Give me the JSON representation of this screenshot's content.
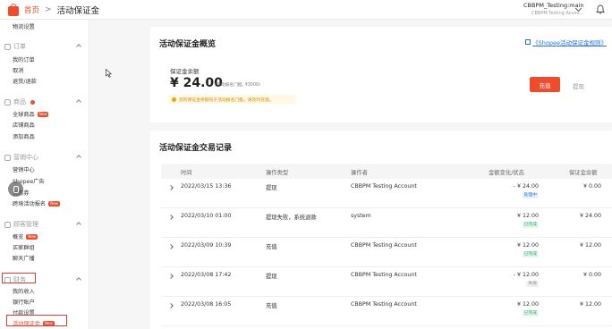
{
  "header": {
    "home_label": "首页",
    "separator": ">",
    "page_title": "活动保证金",
    "shop_name": "CBBPM_Testing:main",
    "shop_sub": "CBBPM Testing Accou..."
  },
  "sidebar": {
    "top_item": "物流设置",
    "sections": [
      {
        "title": "订单",
        "items": [
          "我的订单",
          "取消",
          "退货/退款"
        ]
      },
      {
        "title": "商品",
        "items": [
          "全球商品",
          "店铺商品",
          "添加商品"
        ]
      },
      {
        "title": "营销中心",
        "items": [
          "营销中心",
          "Shopee广告",
          "优惠券",
          "跨境活动报名"
        ]
      },
      {
        "title": "顾客管理",
        "items": [
          "概览",
          "买家群组",
          "聊天广播"
        ]
      },
      {
        "title": "财务",
        "items": [
          "我的收入",
          "银行账户",
          "付款设置",
          "活动保证金"
        ]
      }
    ],
    "new_badge": "New"
  },
  "overview": {
    "title": "活动保证金概览",
    "rule_link": "《Shopee活动保证金规则》",
    "balance_label": "保证金余额",
    "balance_amount": "¥ 24.00",
    "balance_note": "(活动报名门槛, ¥3000)",
    "warning": "您的保证金余额低于活动报名门槛，请及时充值。",
    "recharge_label": "充值",
    "withdraw_label": "提现"
  },
  "transactions": {
    "title": "活动保证金交易记录",
    "headers": [
      "时间",
      "操作类型",
      "操作者",
      "金额变化/状态",
      "保证金余额"
    ],
    "rows": [
      {
        "time": "2022/03/15 13:36",
        "type": "提现",
        "operator": "CBBPM Testing Account",
        "amount": "- ¥ 24.00",
        "status": "处理中",
        "balance": "¥ 0.00"
      },
      {
        "time": "2022/03/10 01:00",
        "type": "提现失败，系统退款",
        "operator": "system",
        "amount": "¥ 12.00",
        "status": "已完成",
        "balance": "¥ 24.00"
      },
      {
        "time": "2022/03/09 10:39",
        "type": "充值",
        "operator": "CBBPM Testing Account",
        "amount": "¥ 12.00",
        "status": "已完成",
        "balance": "¥ 12.00"
      },
      {
        "time": "2022/03/08 17:42",
        "type": "提现",
        "operator": "CBBPM Testing Account",
        "amount": "- ¥ 12.00",
        "status": "失败",
        "balance": "¥ 0.00"
      },
      {
        "time": "2022/03/08 16:05",
        "type": "充值",
        "operator": "CBBPM Testing Account",
        "amount": "¥ 12.00",
        "status": "已完成",
        "balance": "¥ 12.00"
      }
    ]
  },
  "colors": {
    "brand": "#ee4d2d",
    "link": "#2673dd",
    "success": "#26aa63",
    "highlight_box": "#e03a3a"
  }
}
